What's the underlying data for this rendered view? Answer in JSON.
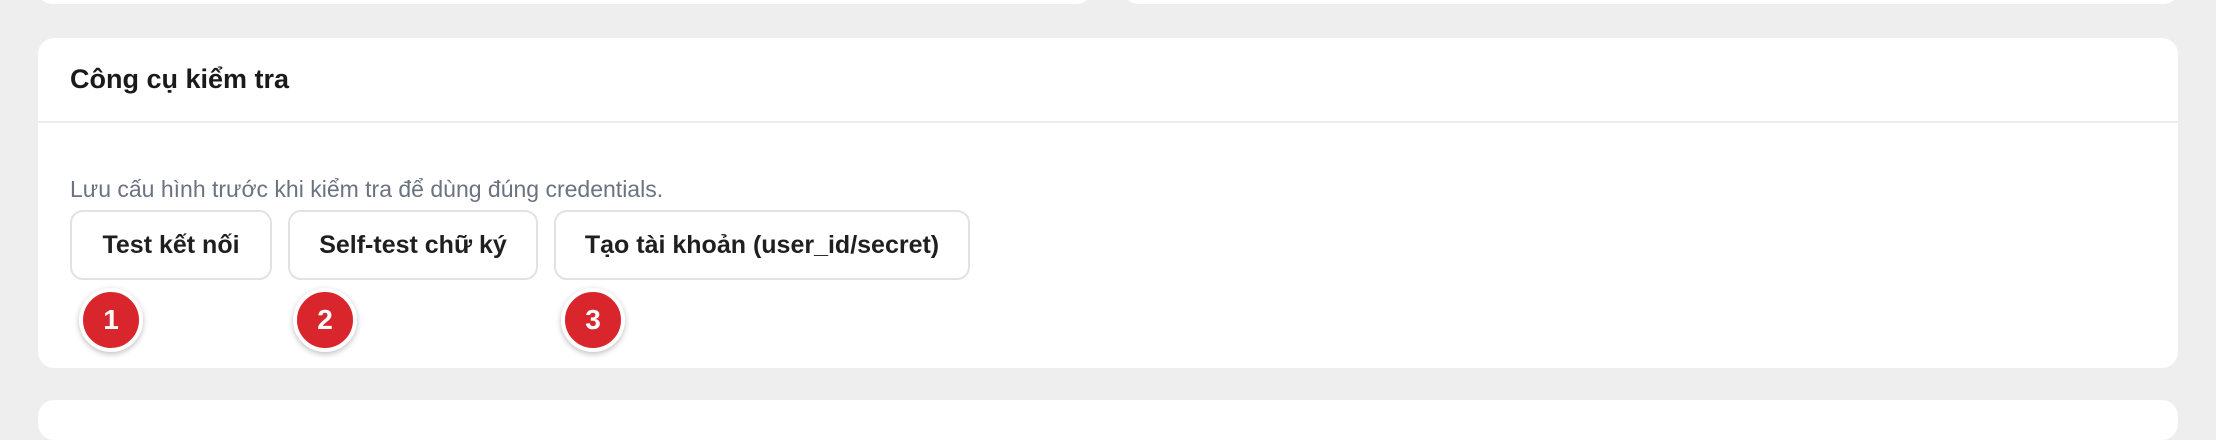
{
  "section": {
    "title": "Công cụ kiểm tra",
    "helper_text": "Lưu cấu hình trước khi kiểm tra để dùng đúng credentials."
  },
  "buttons": {
    "test_connection": "Test kết nối",
    "self_test_signature": "Self-test chữ ký",
    "create_account": "Tạo tài khoản (user_id/secret)"
  },
  "markers": [
    "1",
    "2",
    "3"
  ],
  "colors": {
    "page_background": "#eeeeee",
    "card_background": "#ffffff",
    "marker": "#d9262d",
    "helper_text": "#6b7280"
  }
}
